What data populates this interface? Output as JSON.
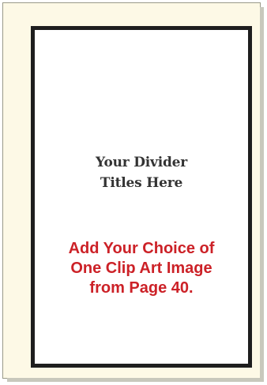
{
  "card": {
    "title_lines": [
      "Your Divider",
      "Titles Here"
    ],
    "note_lines": [
      "Add Your Choice of",
      "One Clip Art Image",
      "from Page 40."
    ]
  },
  "colors": {
    "background": "#fdf9e6",
    "border": "#1e1e1e",
    "title_text": "#333333",
    "note_text": "#cc2127"
  }
}
